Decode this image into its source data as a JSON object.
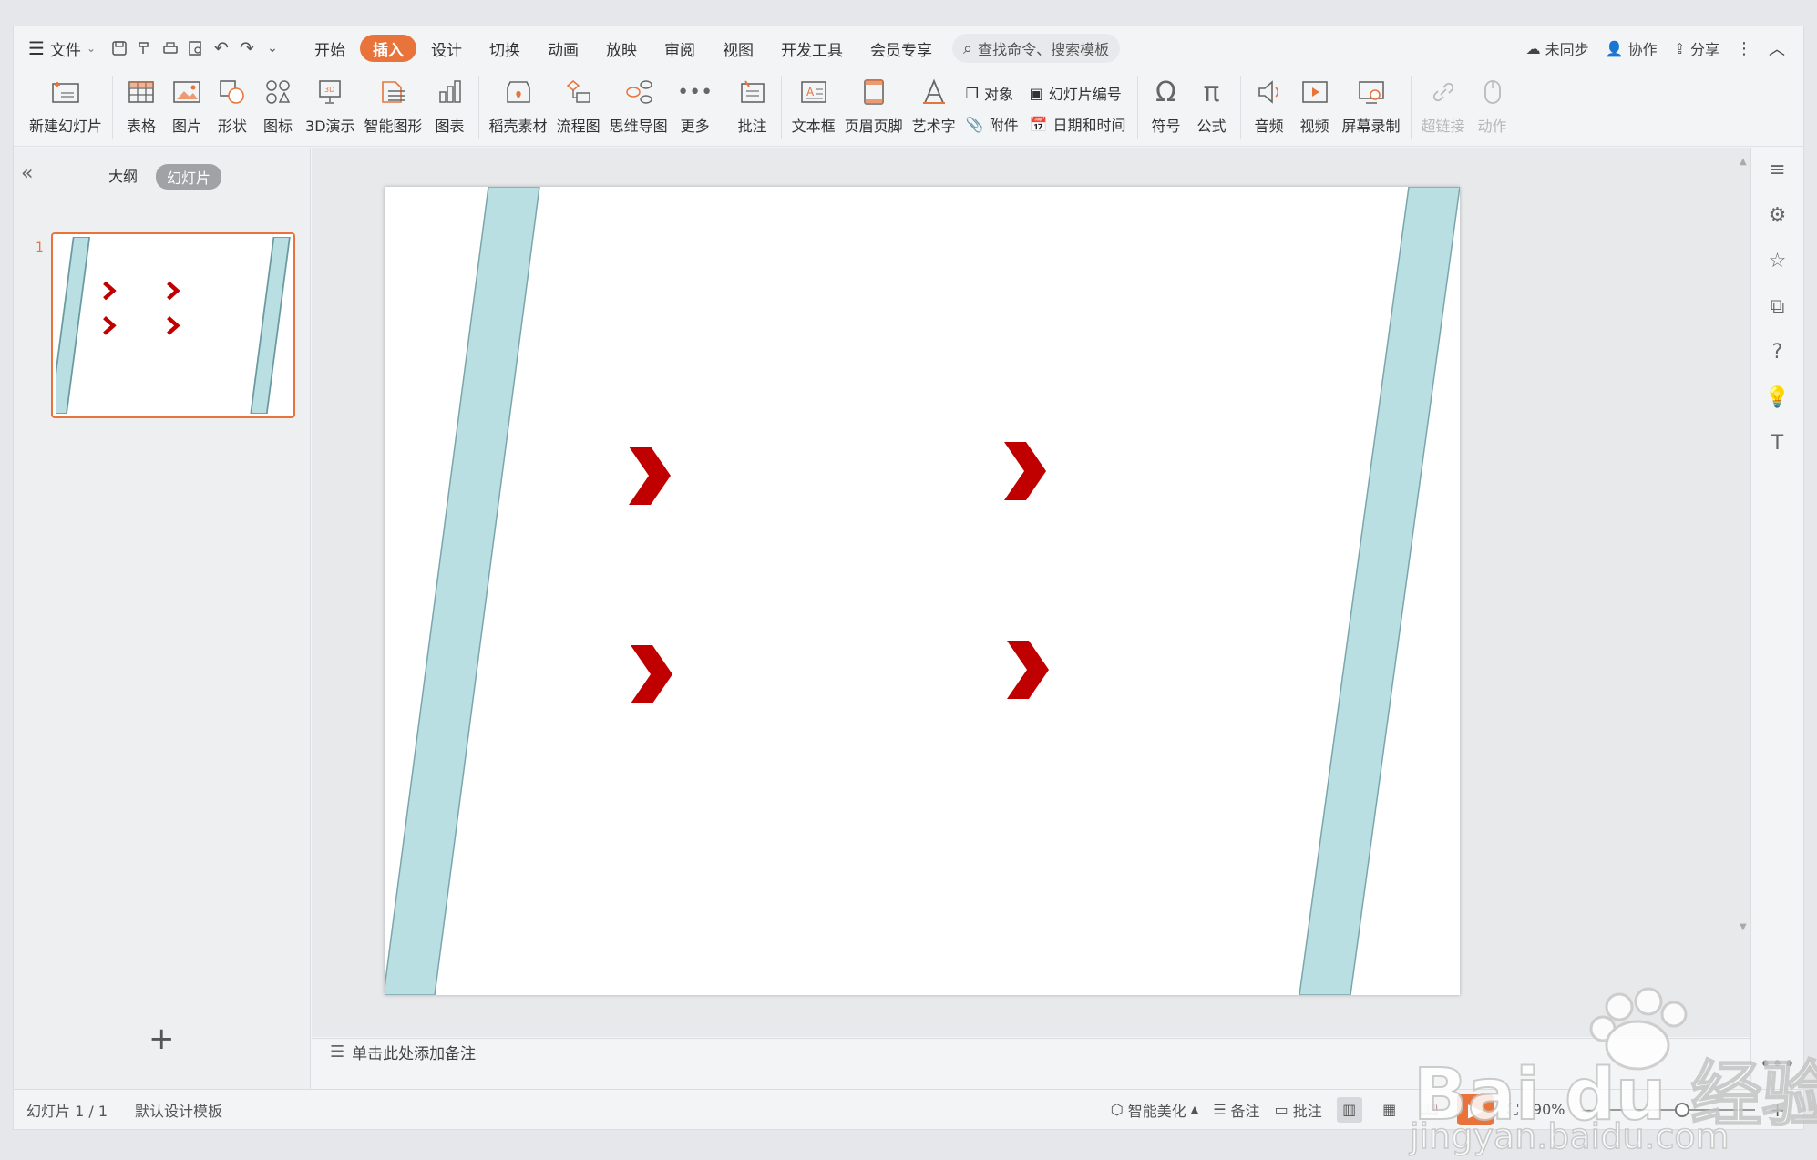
{
  "menubar": {
    "file_label": "文件",
    "tabs": [
      {
        "label": "开始",
        "active": false
      },
      {
        "label": "插入",
        "active": true
      },
      {
        "label": "设计",
        "active": false
      },
      {
        "label": "切换",
        "active": false
      },
      {
        "label": "动画",
        "active": false
      },
      {
        "label": "放映",
        "active": false
      },
      {
        "label": "审阅",
        "active": false
      },
      {
        "label": "视图",
        "active": false
      },
      {
        "label": "开发工具",
        "active": false
      },
      {
        "label": "会员专享",
        "active": false
      }
    ],
    "search_placeholder": "查找命令、搜索模板",
    "sync_label": "未同步",
    "collab_label": "协作",
    "share_label": "分享"
  },
  "ribbon": {
    "new_slide": "新建幻灯片",
    "table": "表格",
    "picture": "图片",
    "shape": "形状",
    "icon": "图标",
    "demo3d": "3D演示",
    "smartart": "智能图形",
    "chart": "图表",
    "material": "稻壳素材",
    "flowchart": "流程图",
    "mindmap": "思维导图",
    "more": "更多",
    "comment": "批注",
    "textbox": "文本框",
    "header_footer": "页眉页脚",
    "wordart": "艺术字",
    "object": "对象",
    "attachment": "附件",
    "slide_number": "幻灯片编号",
    "datetime": "日期和时间",
    "symbol": "符号",
    "formula": "公式",
    "audio": "音频",
    "video": "视频",
    "screen_record": "屏幕录制",
    "hyperlink": "超链接",
    "action": "动作"
  },
  "leftpane": {
    "tab_outline": "大纲",
    "tab_slides": "幻灯片",
    "slide_index": "1"
  },
  "notes": {
    "placeholder": "单击此处添加备注"
  },
  "statusbar": {
    "slide_counter": "幻灯片 1 / 1",
    "template": "默认设计模板",
    "beautify": "智能美化",
    "notes": "备注",
    "comments": "批注",
    "zoom": "90%"
  },
  "slide": {
    "band_color": "#b9dfe2",
    "chevron_color": "#c00000"
  },
  "watermark": {
    "brand": "Bai du 经验",
    "url": "jingyan.baidu.com"
  }
}
